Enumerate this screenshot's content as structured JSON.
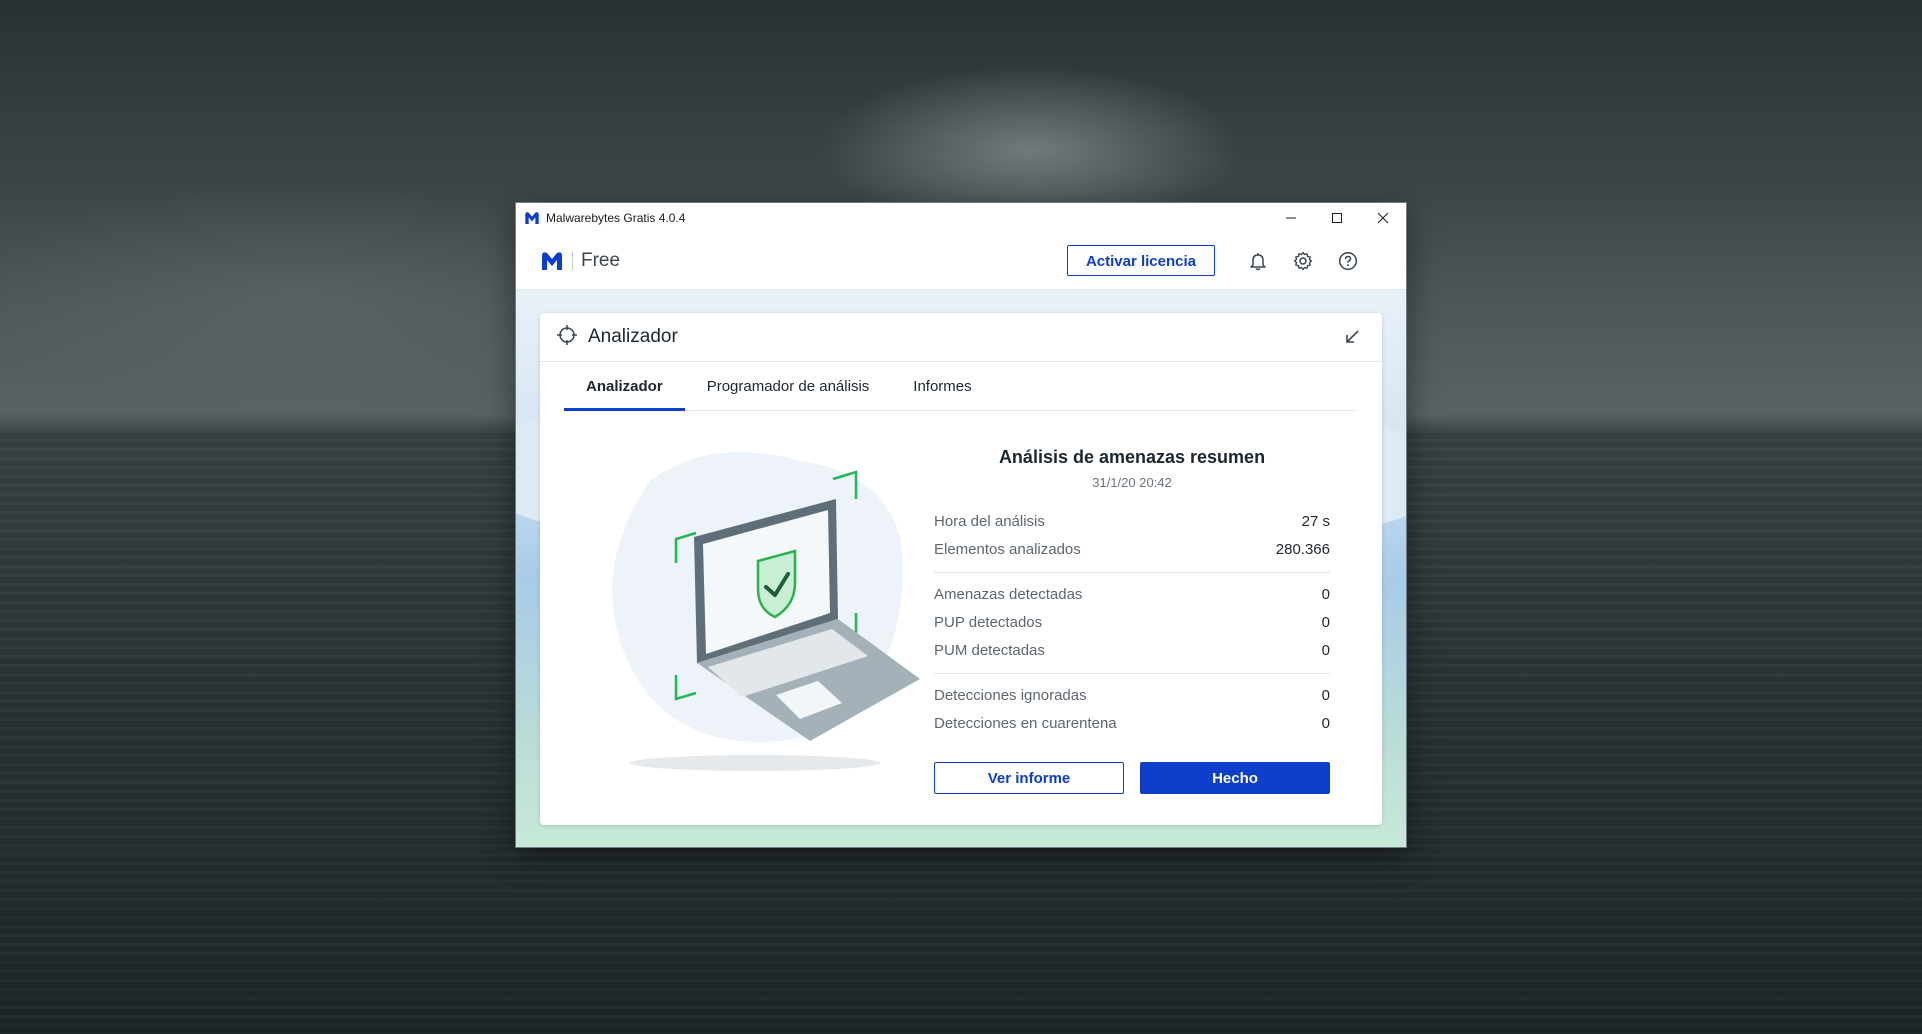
{
  "window": {
    "title": "Malwarebytes Gratis  4.0.4",
    "controls": {
      "minimize": "—",
      "maximize": "☐",
      "close": "✕"
    }
  },
  "header": {
    "brand_name": "Free",
    "activate_label": "Activar licencia",
    "icons": [
      "bell-icon",
      "gear-icon",
      "help-icon"
    ]
  },
  "panel": {
    "title": "Analizador",
    "tabs": [
      {
        "label": "Analizador",
        "active": true
      },
      {
        "label": "Programador de análisis",
        "active": false
      },
      {
        "label": "Informes",
        "active": false
      }
    ]
  },
  "summary": {
    "title": "Análisis de amenazas resumen",
    "date": "31/1/20 20:42",
    "group1": [
      {
        "label": "Hora del análisis",
        "value": "27 s"
      },
      {
        "label": "Elementos analizados",
        "value": "280.366"
      }
    ],
    "group2": [
      {
        "label": "Amenazas detectadas",
        "value": "0"
      },
      {
        "label": "PUP detectados",
        "value": "0"
      },
      {
        "label": "PUM detectadas",
        "value": "0"
      }
    ],
    "group3": [
      {
        "label": "Detecciones ignoradas",
        "value": "0"
      },
      {
        "label": "Detecciones en cuarentena",
        "value": "0"
      }
    ],
    "view_report_label": "Ver informe",
    "done_label": "Hecho"
  },
  "colors": {
    "accent": "#0d3ecc",
    "shield_green": "#1db954"
  }
}
